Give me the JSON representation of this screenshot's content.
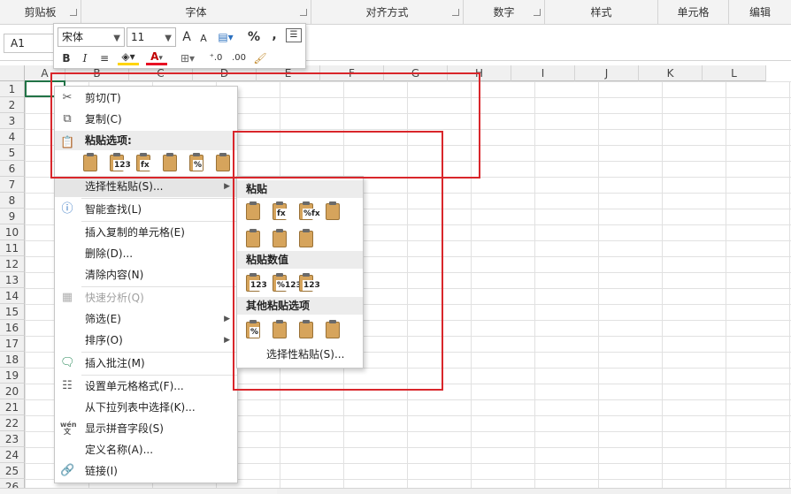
{
  "ribbon": {
    "groups": [
      "剪贴板",
      "字体",
      "对齐方式",
      "数字",
      "样式",
      "单元格",
      "编辑"
    ]
  },
  "formula_bar": {
    "name_box": "A1"
  },
  "sheet": {
    "columns": [
      "A",
      "B",
      "C",
      "D",
      "E",
      "F",
      "G",
      "H",
      "I",
      "J",
      "K",
      "L"
    ],
    "rows": [
      "1",
      "2",
      "3",
      "4",
      "5",
      "6",
      "7",
      "8",
      "9",
      "10",
      "11",
      "12",
      "13",
      "14",
      "15",
      "16",
      "17",
      "18",
      "19",
      "20",
      "21",
      "22",
      "23",
      "24",
      "25",
      "26"
    ]
  },
  "mini_toolbar": {
    "font_name": "宋体",
    "font_size": "11",
    "grow_font": "A",
    "shrink_font": "A",
    "percent": "%",
    "comma": ",",
    "bold": "B",
    "italic": "I",
    "font_color": "A",
    "inc_decimal": "⁺.0",
    "dec_decimal": ".00"
  },
  "context_menu": {
    "cut": "剪切(T)",
    "copy": "复制(C)",
    "paste_options_header": "粘贴选项:",
    "paste_special": "选择性粘贴(S)...",
    "smart_lookup": "智能查找(L)",
    "insert_copied": "插入复制的单元格(E)",
    "delete": "删除(D)...",
    "clear": "清除内容(N)",
    "quick_analysis": "快速分析(Q)",
    "filter": "筛选(E)",
    "sort": "排序(O)",
    "insert_comment": "插入批注(M)",
    "format_cells": "设置单元格格式(F)...",
    "pick_list": "从下拉列表中选择(K)...",
    "phonetic": "显示拼音字段(S)",
    "define_name": "定义名称(A)...",
    "link": "链接(I)",
    "paste_option_tags": [
      "",
      "123",
      "fx",
      "",
      "%",
      ""
    ]
  },
  "submenu": {
    "paste_header": "粘贴",
    "paste_values_header": "粘贴数值",
    "other_header": "其他粘贴选项",
    "paste_special": "选择性粘贴(S)...",
    "paste_tags": [
      "",
      "fx",
      "%fx",
      "",
      "",
      "",
      ""
    ],
    "values_tags": [
      "123",
      "%123",
      "123"
    ],
    "other_tags": [
      "%",
      "",
      "",
      ""
    ]
  },
  "colors": {
    "accent_green": "#217346",
    "annotation_red": "#d9262b",
    "clipboard_orange": "#d6a45c"
  }
}
